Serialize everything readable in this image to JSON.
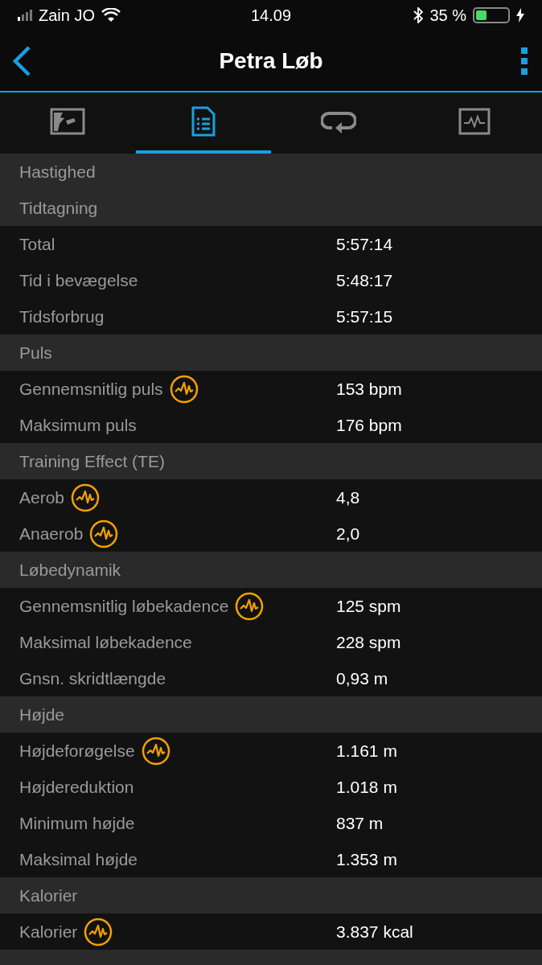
{
  "status_bar": {
    "carrier": "Zain JO",
    "time": "14.09",
    "battery": "35 %"
  },
  "nav": {
    "title": "Petra Løb"
  },
  "tabs": [
    {
      "kind": "map",
      "selected": false
    },
    {
      "kind": "details",
      "selected": true
    },
    {
      "kind": "laps",
      "selected": false
    },
    {
      "kind": "graph",
      "selected": false
    }
  ],
  "sections": [
    {
      "title": "Hastighed"
    },
    {
      "title": "Tidtagning",
      "rows": [
        {
          "label": "Total",
          "value": "5:57:14",
          "chart": false
        },
        {
          "label": "Tid i bevægelse",
          "value": "5:48:17",
          "chart": false
        },
        {
          "label": "Tidsforbrug",
          "value": "5:57:15",
          "chart": false
        }
      ]
    },
    {
      "title": "Puls",
      "rows": [
        {
          "label": "Gennemsnitlig puls",
          "value": "153 bpm",
          "chart": true
        },
        {
          "label": "Maksimum puls",
          "value": "176 bpm",
          "chart": false
        }
      ]
    },
    {
      "title": "Training Effect (TE)",
      "rows": [
        {
          "label": "Aerob",
          "value": "4,8",
          "chart": true
        },
        {
          "label": "Anaerob",
          "value": "2,0",
          "chart": true
        }
      ]
    },
    {
      "title": "Løbedynamik",
      "rows": [
        {
          "label": "Gennemsnitlig løbekadence",
          "value": "125 spm",
          "chart": true
        },
        {
          "label": "Maksimal løbekadence",
          "value": "228 spm",
          "chart": false
        },
        {
          "label": "Gnsn. skridtlængde",
          "value": "0,93 m",
          "chart": false
        }
      ]
    },
    {
      "title": "Højde",
      "rows": [
        {
          "label": "Højdeforøgelse",
          "value": "1.161 m",
          "chart": true
        },
        {
          "label": "Højdereduktion",
          "value": "1.018 m",
          "chart": false
        },
        {
          "label": "Minimum højde",
          "value": "837 m",
          "chart": false
        },
        {
          "label": "Maksimal højde",
          "value": "1.353 m",
          "chart": false
        }
      ]
    },
    {
      "title": "Kalorier",
      "rows": [
        {
          "label": "Kalorier",
          "value": "3.837 kcal",
          "chart": true
        }
      ]
    }
  ]
}
